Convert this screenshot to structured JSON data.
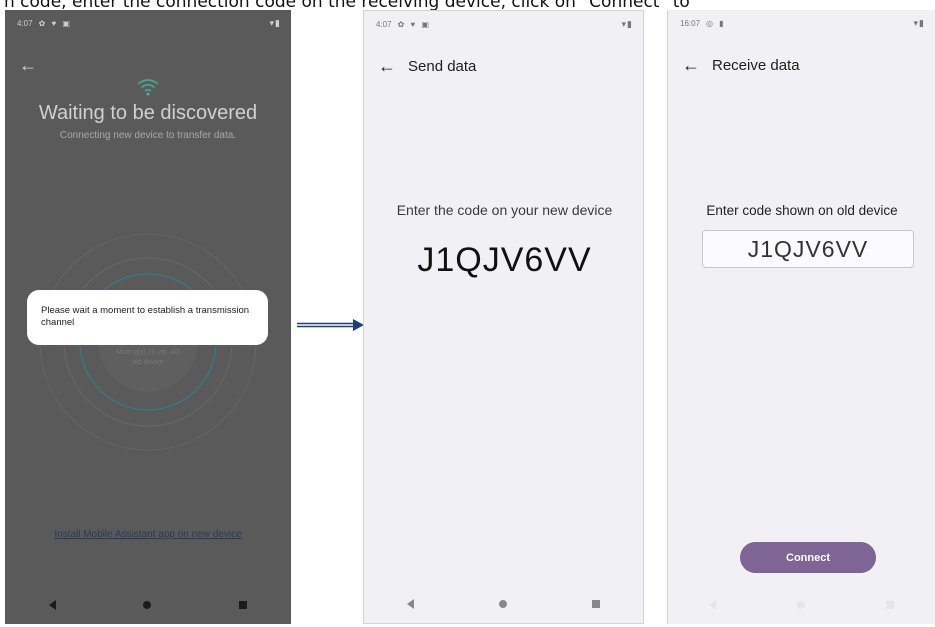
{
  "caption": "n code, enter the connection code on the receiving device, click on \"Connect\" to",
  "left_screen": {
    "status_time": "4:07",
    "status_icons": "✿ ♥ ▣",
    "status_right": "▾▮",
    "title": "Waiting to be discovered",
    "subtitle": "Connecting new device to transfer data.",
    "dialog_text": "Please wait a moment to establish a transmission channel",
    "device_name": "Moto g(x) 20 val. 4G",
    "device_role": "old device",
    "install_link": "Install Mobile Assistant app on new device"
  },
  "middle_screen": {
    "status_time": "4:07",
    "status_icons": "✿ ♥ ▣",
    "status_right": "▾▮",
    "title": "Send data",
    "prompt": "Enter the code on your new device",
    "code": "J1QJV6VV"
  },
  "right_screen": {
    "status_time": "16:07",
    "status_icons": "◎ ▮",
    "status_right": "▾▮",
    "title": "Receive data",
    "prompt": "Enter code shown on old device",
    "code_value": "J1QJV6VV",
    "connect_label": "Connect"
  },
  "colors": {
    "dim_background": "#5a5a5a",
    "screen_background": "#f1f0f5",
    "connect_button": "#7e6595",
    "wifi_teal": "#3ea89a",
    "arrow": "#1f3f7a"
  },
  "icons": [
    "back-arrow-icon",
    "wifi-icon",
    "nav-back-icon",
    "nav-home-icon",
    "nav-recent-icon",
    "right-arrow-icon"
  ]
}
